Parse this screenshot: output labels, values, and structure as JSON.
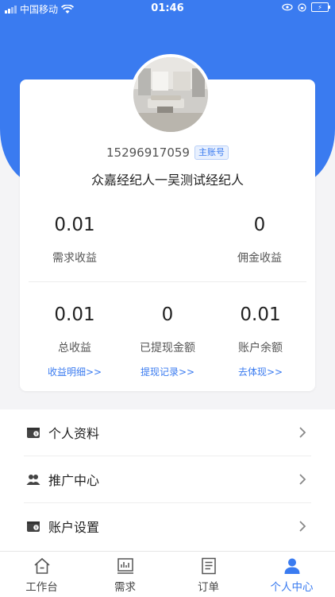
{
  "status_bar": {
    "carrier": "中国移动",
    "time": "01:46",
    "battery_icon": "battery-charging-icon"
  },
  "profile": {
    "phone": "15296917059",
    "account_badge": "主账号",
    "agent_name": "众嘉经纪人一吴测试经纪人"
  },
  "stats": {
    "demand_income": {
      "value": "0.01",
      "label": "需求收益"
    },
    "commission_income": {
      "value": "0",
      "label": "佣金收益"
    },
    "total_income": {
      "value": "0.01",
      "label": "总收益",
      "link": "收益明细>>"
    },
    "withdrawn_amount": {
      "value": "0",
      "label": "已提现金额",
      "link": "提现记录>>"
    },
    "account_balance": {
      "value": "0.01",
      "label": "账户余额",
      "link": "去体现>>"
    }
  },
  "menu": [
    {
      "label": "个人资料",
      "icon": "wallet-icon"
    },
    {
      "label": "推广中心",
      "icon": "users-icon"
    },
    {
      "label": "账户设置",
      "icon": "wallet-icon"
    }
  ],
  "tabs": [
    {
      "label": "工作台",
      "icon": "home-icon",
      "active": false
    },
    {
      "label": "需求",
      "icon": "chart-icon",
      "active": false
    },
    {
      "label": "订单",
      "icon": "document-icon",
      "active": false
    },
    {
      "label": "个人中心",
      "icon": "person-icon",
      "active": true
    }
  ],
  "colors": {
    "primary": "#3a7bf0",
    "background": "#f4f4f6",
    "text": "#222222"
  }
}
